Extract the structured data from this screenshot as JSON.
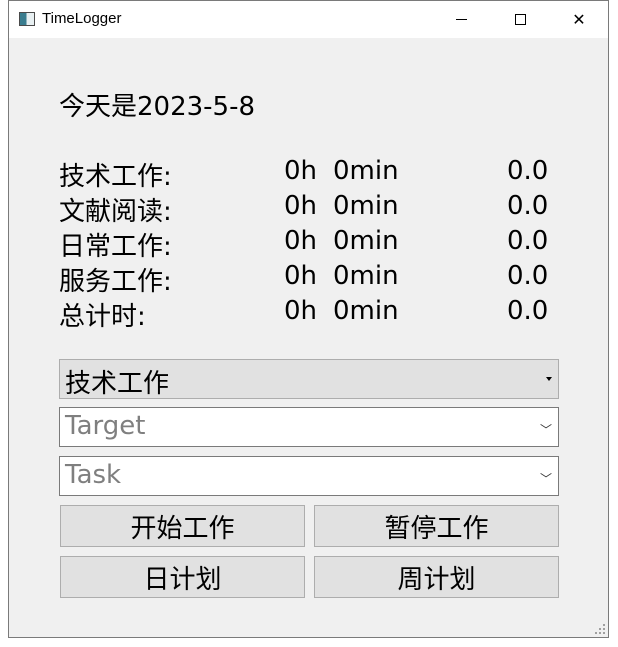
{
  "window": {
    "title": "TimeLogger"
  },
  "date_label": "今天是2023-5-8",
  "stats": [
    {
      "label": "技术工作:",
      "hours": "0h",
      "minutes": "0min",
      "value": "0.0"
    },
    {
      "label": "文献阅读:",
      "hours": "0h",
      "minutes": "0min",
      "value": "0.0"
    },
    {
      "label": "日常工作:",
      "hours": "0h",
      "minutes": "0min",
      "value": "0.0"
    },
    {
      "label": "服务工作:",
      "hours": "0h",
      "minutes": "0min",
      "value": "0.0"
    },
    {
      "label": "总计时:",
      "hours": "0h",
      "minutes": "0min",
      "value": "0.0"
    }
  ],
  "category_select": {
    "value": "技术工作"
  },
  "target_select": {
    "placeholder": "Target"
  },
  "task_select": {
    "placeholder": "Task"
  },
  "buttons": {
    "start": "开始工作",
    "pause": "暂停工作",
    "daily_plan": "日计划",
    "weekly_plan": "周计划"
  }
}
